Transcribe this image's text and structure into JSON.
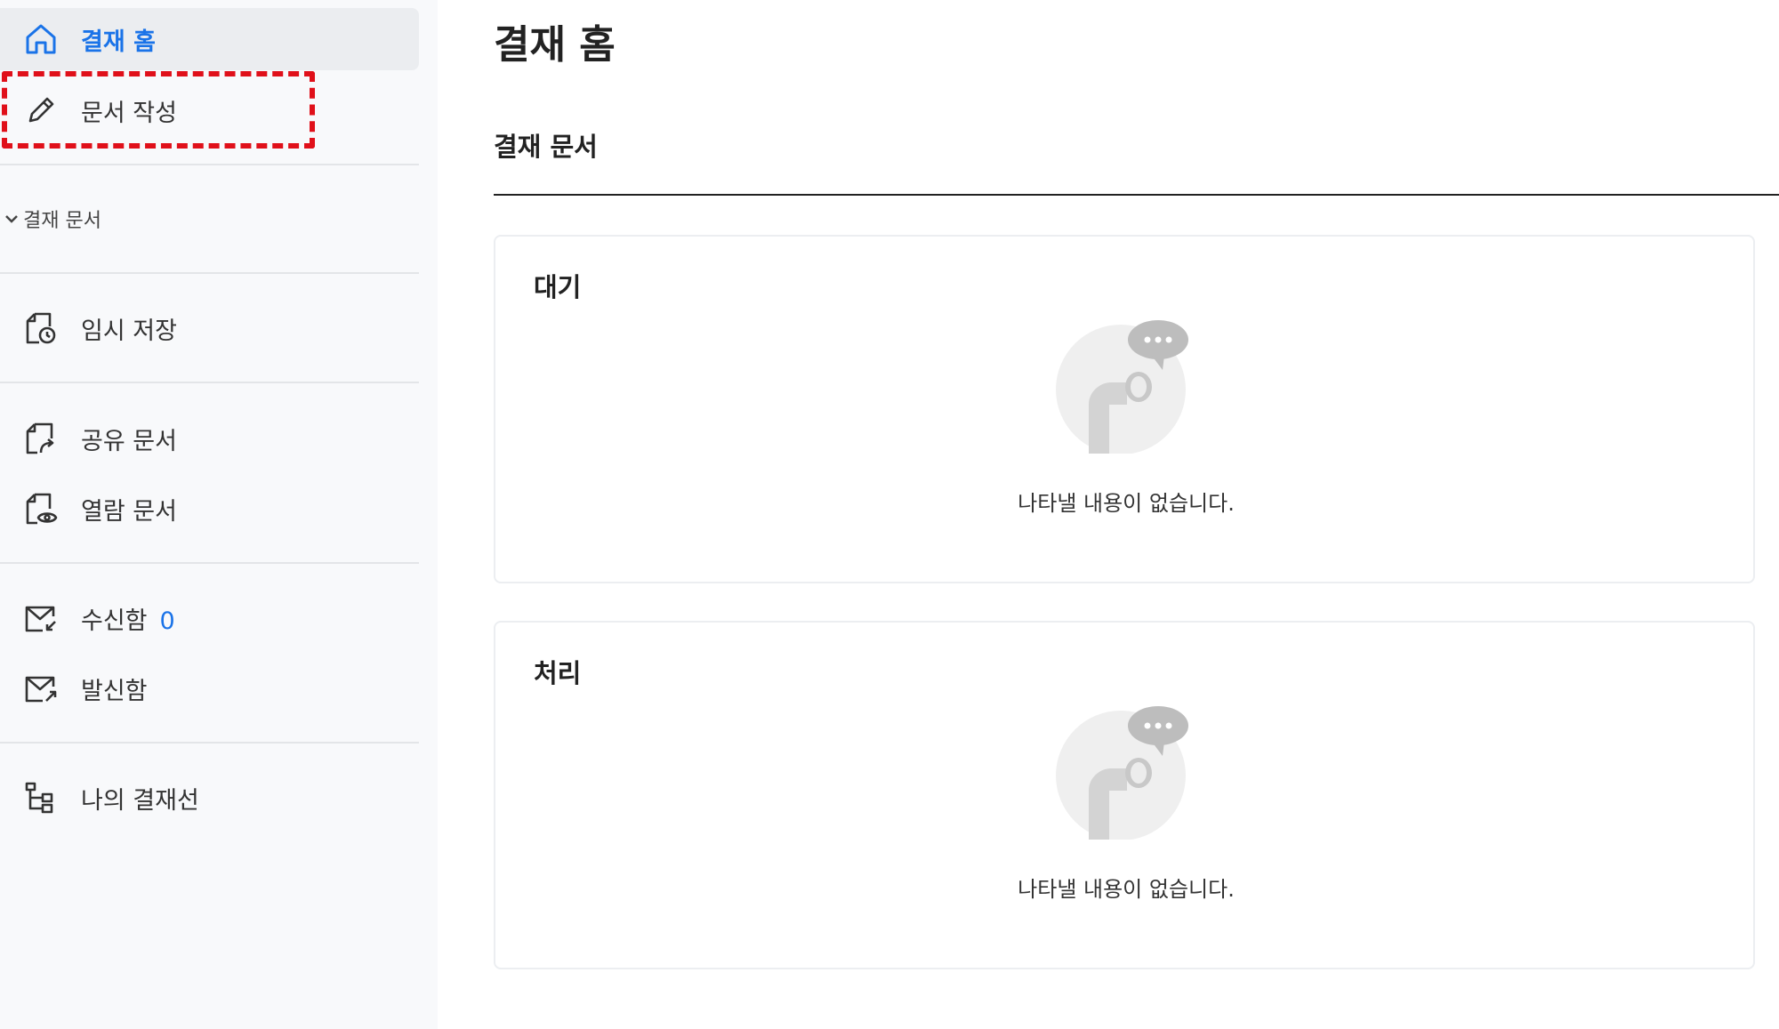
{
  "sidebar": {
    "home_label": "결재 홈",
    "write_label": "문서 작성",
    "section_label": "결재 문서",
    "temp_save_label": "임시 저장",
    "shared_label": "공유 문서",
    "viewed_label": "열람 문서",
    "inbox_label": "수신함",
    "inbox_count": "0",
    "outbox_label": "발신함",
    "approval_line_label": "나의 결재선"
  },
  "main": {
    "title": "결재 홈",
    "tab_label": "결재 문서",
    "cards": [
      {
        "title": "대기",
        "empty_text": "나타낼 내용이 없습니다."
      },
      {
        "title": "처리",
        "empty_text": "나타낼 내용이 없습니다."
      }
    ]
  },
  "colors": {
    "accent": "#1a73e8",
    "highlight": "#e0101a",
    "sidebar_bg": "#f8f9fb"
  },
  "icons": [
    "home-icon",
    "pencil-icon",
    "chevron-down-icon",
    "temp-save-icon",
    "share-doc-icon",
    "view-doc-icon",
    "inbox-icon",
    "outbox-icon",
    "approval-line-icon",
    "empty-chat-icon"
  ]
}
